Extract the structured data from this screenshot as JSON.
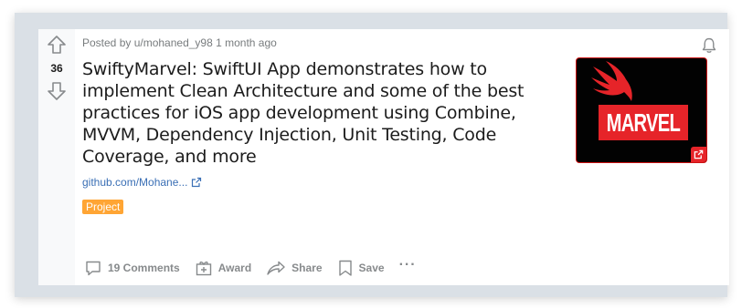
{
  "post": {
    "score": "36",
    "meta": "Posted by u/mohaned_y98 1 month ago",
    "title": "SwiftyMarvel: SwiftUI App demonstrates how to implement Clean Architecture and some of the best practices for iOS app development using Combine, MVVM, Dependency Injection, Unit Testing, Code Coverage, and more",
    "link_text": "github.com/Mohane...",
    "flair": "Project",
    "thumbnail_text": "MARVEL",
    "colors": {
      "flair_bg": "#ffa534",
      "brand_red": "#e62429",
      "link": "#3a6fb5"
    }
  },
  "actions": {
    "comments": "19 Comments",
    "award": "Award",
    "share": "Share",
    "save": "Save",
    "more": "···"
  },
  "icons": [
    "upvote-icon",
    "downvote-icon",
    "bell-icon",
    "external-link-icon",
    "comment-icon",
    "award-icon",
    "share-icon",
    "bookmark-icon",
    "more-icon"
  ]
}
